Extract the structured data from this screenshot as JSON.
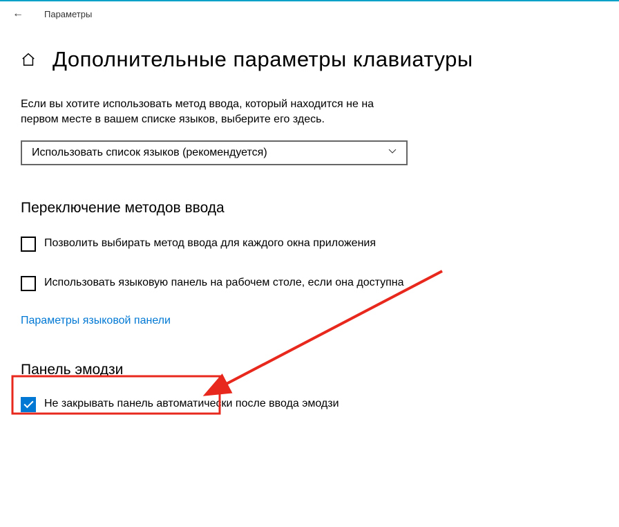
{
  "titlebar": {
    "label": "Параметры"
  },
  "page": {
    "title": "Дополнительные параметры клавиатуры"
  },
  "intro": "Если вы хотите использовать метод ввода, который находится не на первом месте в вашем списке языков, выберите его здесь.",
  "select": {
    "value": "Использовать список языков (рекомендуется)"
  },
  "section_switch": {
    "title": "Переключение методов ввода"
  },
  "checkbox_per_window": {
    "label": "Позволить выбирать метод ввода для каждого окна приложения"
  },
  "checkbox_langbar": {
    "label": "Использовать языковую панель на рабочем столе, если она доступна"
  },
  "link_langbar": "Параметры языковой панели",
  "section_emoji": {
    "title": "Панель эмодзи"
  },
  "checkbox_emoji": {
    "label": "Не закрывать панель автоматически после ввода эмодзи"
  }
}
